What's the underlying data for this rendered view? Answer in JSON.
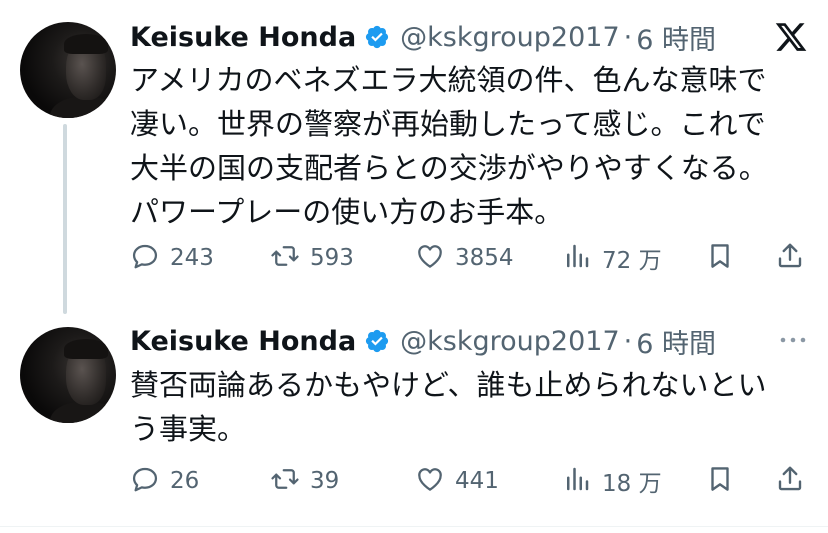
{
  "tweets": [
    {
      "author_name": "Keisuke Honda",
      "handle": "@kskgroup2017",
      "separator": "·",
      "time": "6 時間",
      "text": "アメリカのベネズエラ大統領の件、色んな意味で\n凄い。世界の警察が再始動したって感じ。これで\n大半の国の支配者らとの交渉がやりやすくなる。\nパワープレーの使い方のお手本。",
      "replies": "243",
      "reposts": "593",
      "likes": "3854",
      "views": "72 万"
    },
    {
      "author_name": "Keisuke Honda",
      "handle": "@kskgroup2017",
      "separator": "·",
      "time": "6 時間",
      "text": "賛否両論あるかもやけど、誰も止められないとい\nう事実。",
      "replies": "26",
      "reposts": "39",
      "likes": "441",
      "views": "18 万"
    }
  ],
  "colors": {
    "text": "#0f1419",
    "secondary": "#536471",
    "verified": "#1d9bf0",
    "thread_line": "#cfd9de"
  },
  "icons": [
    "x-logo-icon",
    "verified-badge-icon",
    "reply-icon",
    "repost-icon",
    "like-icon",
    "views-icon",
    "bookmark-icon",
    "share-icon",
    "more-icon"
  ]
}
